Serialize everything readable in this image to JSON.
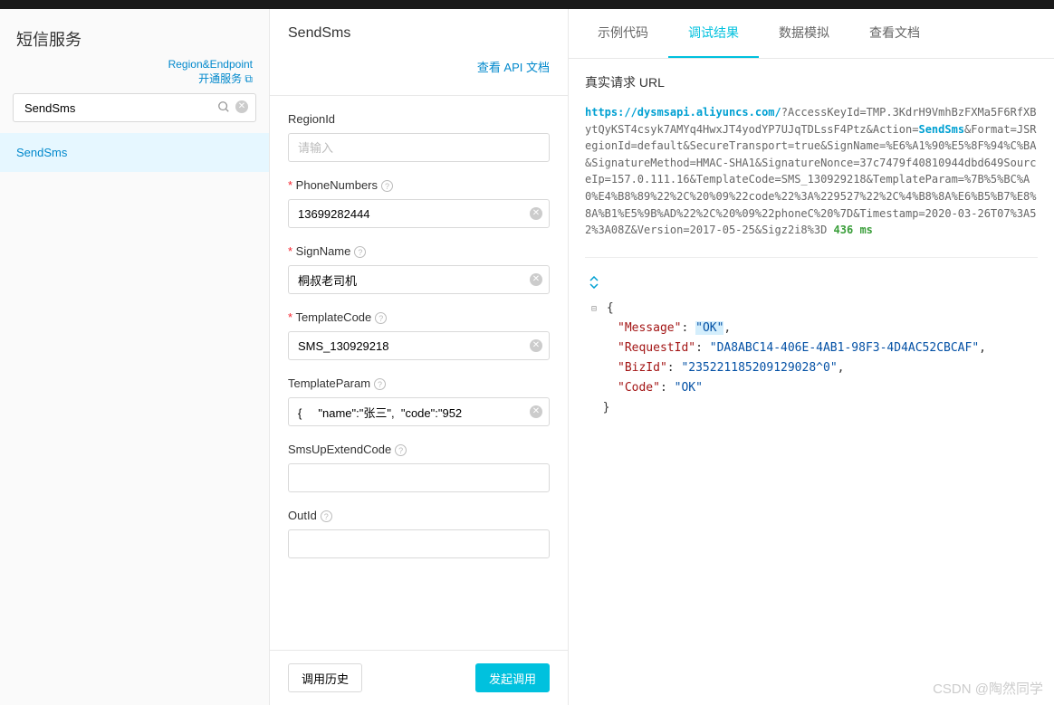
{
  "left": {
    "title": "短信服务",
    "links": {
      "region": "Region&Endpoint",
      "open_service": "开通服务"
    },
    "search": {
      "value": "SendSms"
    },
    "nav_item": "SendSms"
  },
  "middle": {
    "title": "SendSms",
    "api_doc_link": "查看 API 文档",
    "fields": {
      "region": {
        "label": "RegionId",
        "placeholder": "请输入",
        "value": ""
      },
      "phone": {
        "label": "PhoneNumbers",
        "value": "13699282444"
      },
      "sign": {
        "label": "SignName",
        "value": "桐叔老司机"
      },
      "template_code": {
        "label": "TemplateCode",
        "value": "SMS_130929218"
      },
      "template_param": {
        "label": "TemplateParam",
        "value": "{     \"name\":\"张三\",  \"code\":\"952"
      },
      "sms_up": {
        "label": "SmsUpExtendCode",
        "value": ""
      },
      "out_id": {
        "label": "OutId",
        "value": ""
      }
    },
    "footer": {
      "history": "调用历史",
      "invoke": "发起调用"
    }
  },
  "right": {
    "tabs": [
      "示例代码",
      "调试结果",
      "数据模拟",
      "查看文档"
    ],
    "active_tab": 1,
    "section_title": "真实请求 URL",
    "url": {
      "base": "https://dysmsapi.aliyuncs.com/",
      "part1": "?AccessKeyId=TMP.3KdrH9VmhBzFXMa5F6RfXBytQyKST4csyk7AMYq4HwxJT4yodYP7UJqTDLssF4Ptz&Action=",
      "action": "SendSms",
      "part2": "&Format=JSRegionId=default&SecureTransport=true&SignName=%E6%A1%90%E5%8F%94%C%BA&SignatureMethod=HMAC-SHA1&SignatureNonce=37c7479f40810944dbd649SourceIp=157.0.111.16&TemplateCode=SMS_130929218&TemplateParam=%7B%5%BC%A0%E4%B8%89%22%2C%20%09%22code%22%3A%229527%22%2C%4%B8%8A%E6%B5%B7%E8%8A%B1%E5%9B%AD%22%2C%20%09%22phoneC%20%7D&Timestamp=2020-03-26T07%3A52%3A08Z&Version=2017-05-25&Sigz2i8%3D  ",
      "ms": "436 ms"
    },
    "json": {
      "Message": "OK",
      "RequestId": "DA8ABC14-406E-4AB1-98F3-4D4AC52CBCAF",
      "BizId": "235221185209129028^0",
      "Code": "OK"
    }
  },
  "watermark": "CSDN @陶然同学"
}
